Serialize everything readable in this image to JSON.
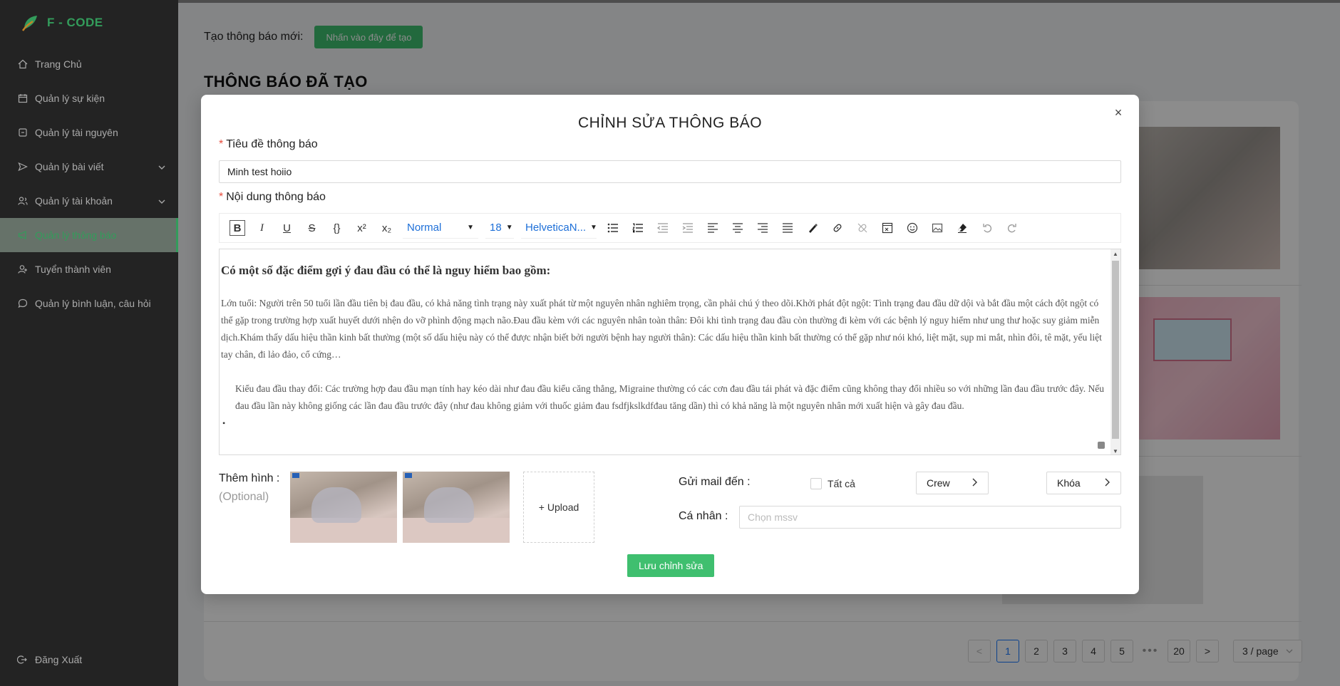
{
  "brand": {
    "name": "F - CODE"
  },
  "sidebar": {
    "items": [
      {
        "label": "Trang Chủ",
        "icon": "home-icon"
      },
      {
        "label": "Quản lý sự kiện",
        "icon": "calendar-icon"
      },
      {
        "label": "Quản lý tài nguyên",
        "icon": "box-icon"
      },
      {
        "label": "Quản lý bài viết",
        "icon": "send-icon",
        "expandable": true
      },
      {
        "label": "Quản lý tài khoản",
        "icon": "users-icon",
        "expandable": true
      },
      {
        "label": "Quản lý thông báo",
        "icon": "megaphone-icon",
        "active": true
      },
      {
        "label": "Tuyển thành viên",
        "icon": "user-add-icon"
      },
      {
        "label": "Quản lý bình luận, câu hỏi",
        "icon": "comment-icon"
      }
    ],
    "logout": "Đăng Xuất"
  },
  "page": {
    "create_label": "Tạo thông báo mới:",
    "create_button": "Nhấn vào đây để tạo",
    "section_title": "THÔNG BÁO ĐÃ TẠO"
  },
  "pagination": {
    "prev": "<",
    "pages": [
      "1",
      "2",
      "3",
      "4",
      "5"
    ],
    "active": "1",
    "ellipsis": "•••",
    "last": "20",
    "next": ">",
    "page_size": "3 / page"
  },
  "modal": {
    "title": "CHỈNH SỬA THÔNG BÁO",
    "close": "×",
    "title_label": "Tiêu đề thông báo",
    "title_value": "Minh test hoiio",
    "content_label": "Nội dung thông báo",
    "toolbar": {
      "header_select": "Normal",
      "size_select": "18",
      "font_select": "HelveticaN..."
    },
    "editor": {
      "heading": "Có một số đặc điểm gợi ý đau đầu có thể là nguy hiểm bao gồm:",
      "paragraph": "Lớn tuổi: Người trên 50 tuổi lần đầu tiên bị đau đầu, có khả năng tình trạng này xuất phát từ một nguyên nhân nghiêm trọng, cần phải chú ý theo dõi.Khởi phát đột ngột: Tình trạng đau đầu dữ dội và bắt đầu một cách đột ngột có thể gặp trong trường hợp xuất huyết dưới nhện do vỡ phình động mạch não.Đau đầu kèm với các nguyên nhân toàn thân: Đôi khi tình trạng đau đầu còn thường đi kèm với các bệnh lý nguy hiểm như ung thư hoặc suy giảm miễn dịch.Khám thấy dấu hiệu thần kinh bất thường (một số dấu hiệu này có thể được nhận biết bởi người bệnh hay người thân): Các dấu hiệu thần kinh bất thường có thể gặp như nói khó, liệt mặt, sụp mi mắt, nhìn đôi, tê mặt, yếu liệt tay chân, đi lảo đảo, cổ cứng…",
      "list_item": "Kiểu đau đầu thay đổi: Các trường hợp đau đầu mạn tính hay kéo dài như đau đầu kiểu căng thẳng, Migraine thường có các cơn đau đầu tái phát và đặc điểm cũng không thay đổi nhiều so với những lần đau đầu trước đây. Nếu đau đầu lần này không giống các lần đau đầu trước đây (như đau không giảm với thuốc giảm đau fsdfjkslkdfđau tăng dần) thì có khả năng là một nguyên nhân mới xuất hiện và gây đau đầu."
    },
    "images_label": "Thêm hình :",
    "images_optional": "(Optional)",
    "upload_label": "Upload",
    "mail_label": "Gửi mail đến :",
    "all_label": "Tất cả",
    "crew_label": "Crew",
    "khoa_label": "Khóa",
    "personal_label": "Cá nhân :",
    "personal_placeholder": "Chọn mssv",
    "save_button": "Lưu chỉnh sửa"
  },
  "colors": {
    "accent": "#3fbf6f",
    "sidebar_bg": "#2b2b2b",
    "link_blue": "#1677ff"
  }
}
